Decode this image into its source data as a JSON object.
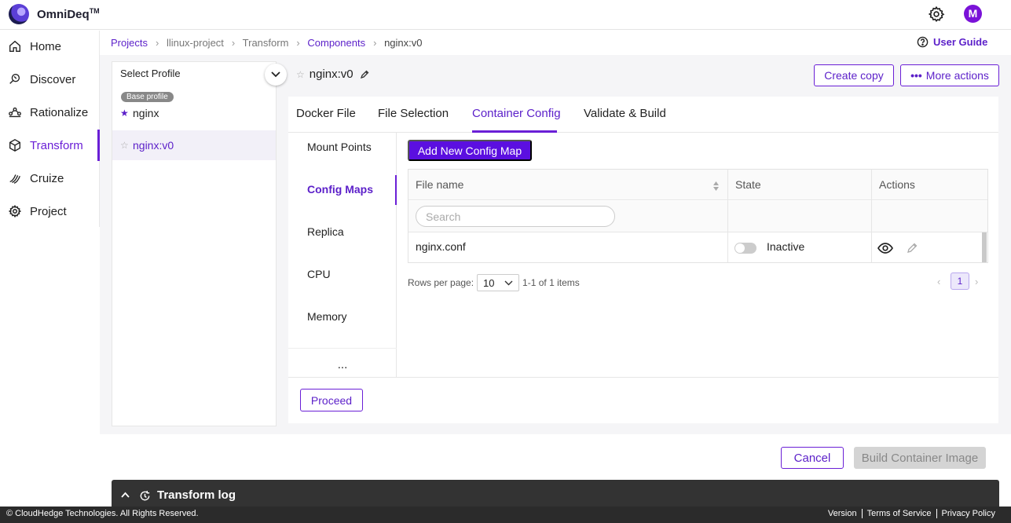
{
  "app": {
    "brand": "OmniDeq",
    "trademark": "TM",
    "avatar_initial": "M"
  },
  "sidebar": {
    "items": [
      {
        "label": "Home",
        "icon": "home-icon"
      },
      {
        "label": "Discover",
        "icon": "discover-icon"
      },
      {
        "label": "Rationalize",
        "icon": "rationalize-icon"
      },
      {
        "label": "Transform",
        "icon": "cube-icon"
      },
      {
        "label": "Cruize",
        "icon": "cruize-icon"
      },
      {
        "label": "Project",
        "icon": "gear-icon"
      }
    ],
    "active": "Transform"
  },
  "breadcrumb": [
    "Projects",
    "llinux-project",
    "Transform",
    "Components",
    "nginx:v0"
  ],
  "user_guide": "User Guide",
  "profiles": {
    "select_label": "Select Profile",
    "base_badge": "Base profile",
    "items": [
      {
        "label": "nginx",
        "starred": true
      },
      {
        "label": "nginx:v0",
        "starred": false
      }
    ]
  },
  "component": {
    "title": "nginx:v0"
  },
  "actions": {
    "create_copy": "Create copy",
    "more_actions": "More actions"
  },
  "tabs": [
    "Docker File",
    "File Selection",
    "Container Config",
    "Validate & Build"
  ],
  "active_tab": "Container Config",
  "subnav": {
    "items": [
      "Mount Points",
      "Config Maps",
      "Replica",
      "CPU",
      "Memory"
    ],
    "active": "Config Maps",
    "more": "..."
  },
  "config_maps": {
    "add_button": "Add New Config Map",
    "columns": [
      "File name",
      "State",
      "Actions"
    ],
    "search_placeholder": "Search",
    "rows": [
      {
        "file_name": "nginx.conf",
        "state": "Inactive",
        "enabled": false
      }
    ],
    "pager": {
      "rows_label": "Rows per page:",
      "rows_value": "10",
      "range": "1-1 of 1 items",
      "current_page": "1"
    }
  },
  "proceed": "Proceed",
  "cancel": "Cancel",
  "build": "Build Container Image",
  "log": {
    "title": "Transform log"
  },
  "footer": {
    "copyright": "© CloudHedge Technologies. All Rights Reserved.",
    "links": [
      "Version",
      "Terms of Service",
      "Privacy Policy"
    ]
  },
  "colors": {
    "accent": "#6a1fd6",
    "accent_dark": "#5b0fe0",
    "log_bar": "#333333"
  }
}
